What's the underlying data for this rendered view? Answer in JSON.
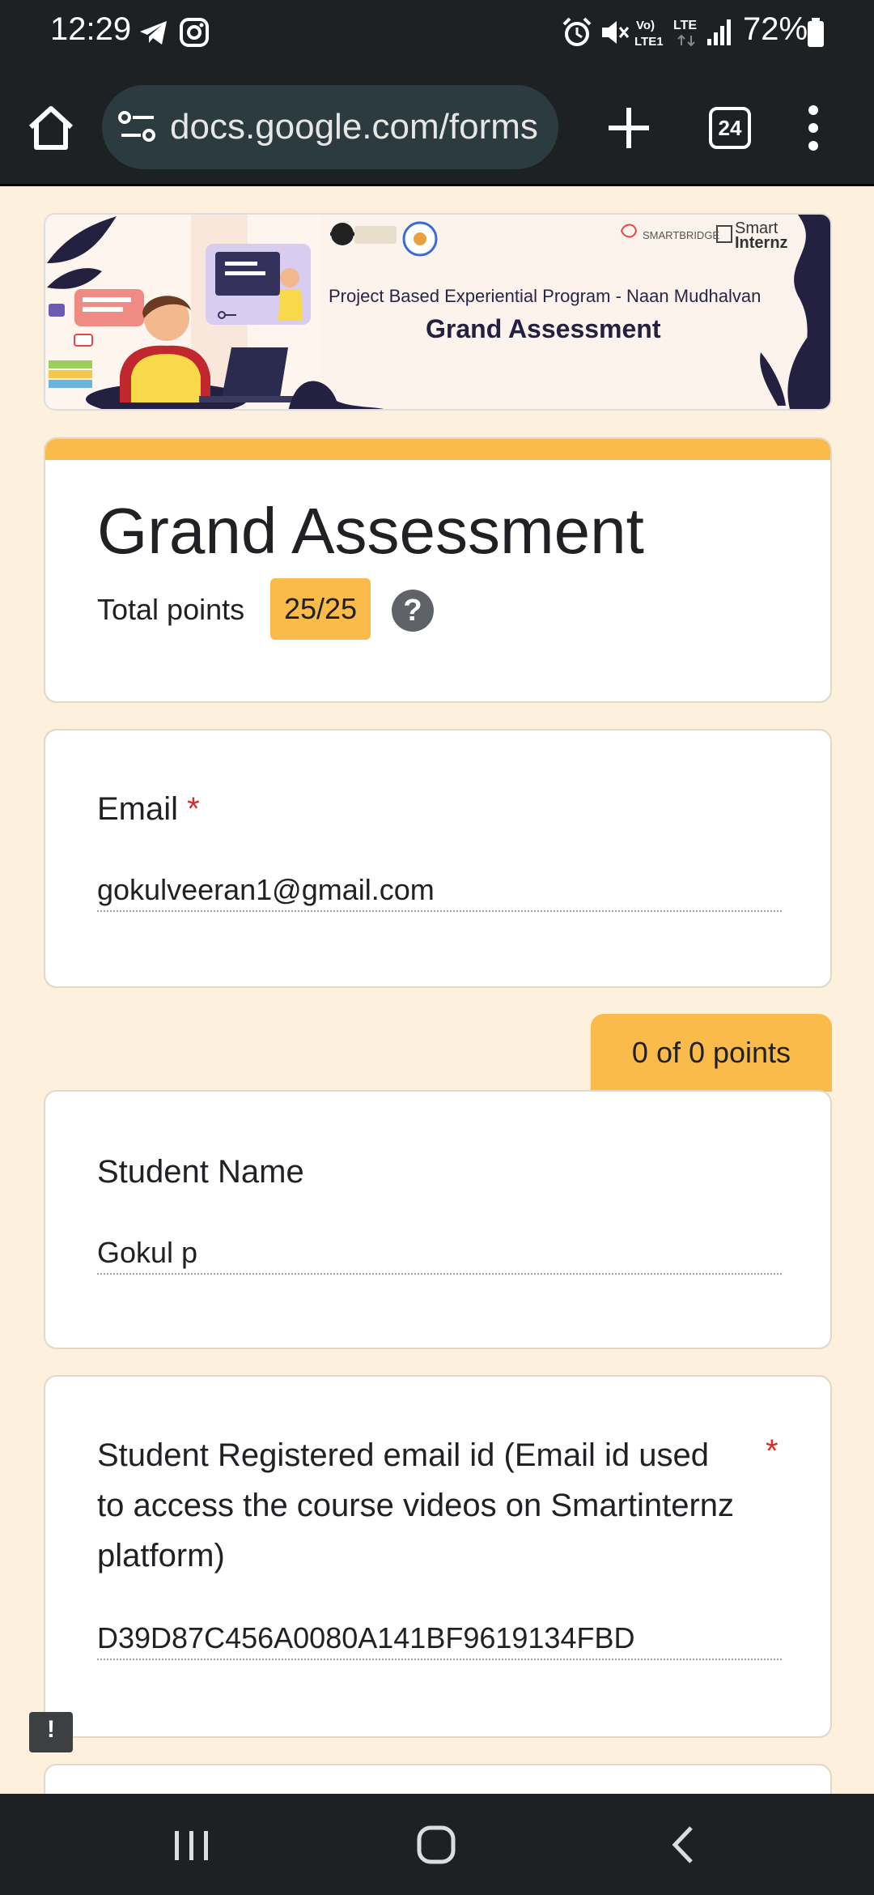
{
  "status_bar": {
    "time": "12:29",
    "battery": "72%",
    "network": "LTE",
    "icons": [
      "telegram-icon",
      "instagram-icon",
      "alarm-icon",
      "mute-icon",
      "volte-icon",
      "lte-icon",
      "signal-icon",
      "battery-icon"
    ]
  },
  "browser": {
    "url": "docs.google.com/forms",
    "tab_count": "24"
  },
  "banner": {
    "subtitle": "Project Based Experiential Program - Naan Mudhalvan",
    "title": "Grand Assessment",
    "partner_1": "SMARTBRIDGE",
    "partner_2_line1": "Smart",
    "partner_2_line2": "Internz"
  },
  "form": {
    "title": "Grand Assessment",
    "total_points_label": "Total points",
    "total_points_value": "25/25",
    "help_symbol": "?"
  },
  "questions": {
    "email": {
      "label": "Email",
      "required_mark": "*",
      "answer": "gokulveeran1@gmail.com"
    },
    "points_tab": "0 of 0 points",
    "student_name": {
      "label": "Student Name",
      "answer": "Gokul p"
    },
    "registered_email": {
      "label": "Student Registered email id (Email id used to access the course videos on Smartinternz platform)",
      "required_mark": "*",
      "answer": "D39D87C456A0080A141BF9619134FBD"
    }
  },
  "feedback_symbol": "!",
  "colors": {
    "accent": "#fbbb4a",
    "background": "#fdf0dc",
    "required": "#d93025",
    "chrome": "#1e2124"
  }
}
